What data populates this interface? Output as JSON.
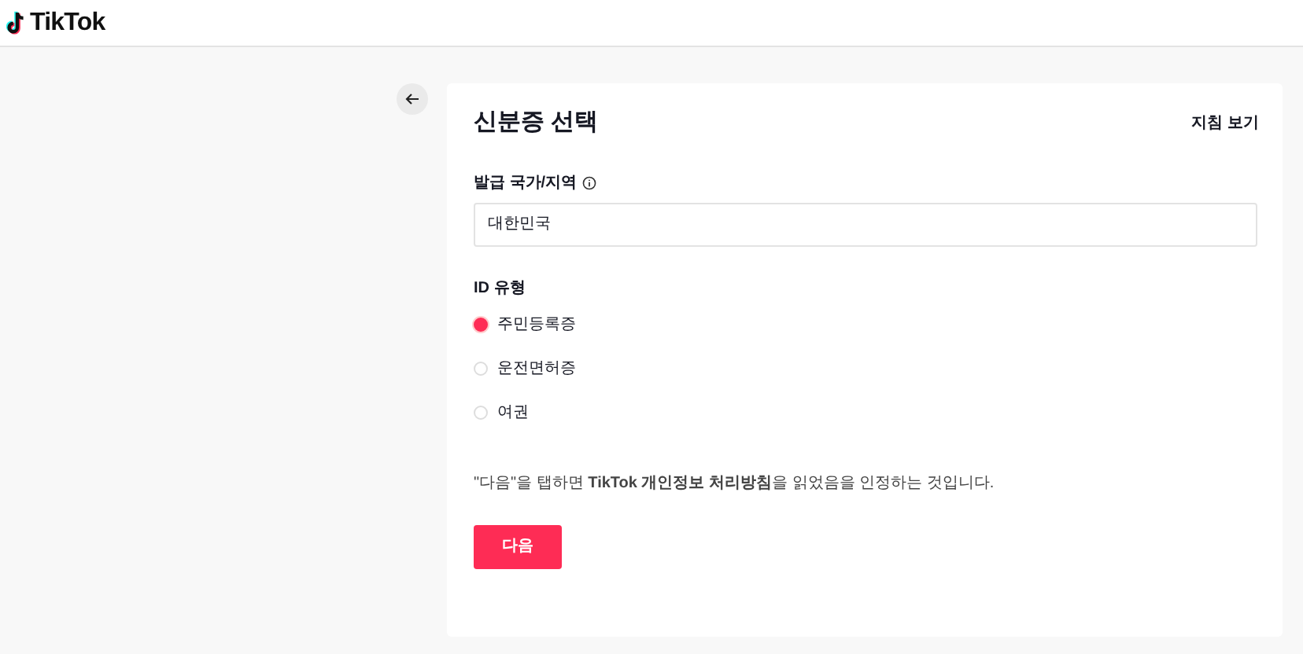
{
  "header": {
    "logo": "TikTok"
  },
  "card": {
    "title": "신분증 선택",
    "guide_link": "지침 보기",
    "country_label": "발급 국가/지역",
    "country_value": "대한민국",
    "id_type_label": "ID 유형",
    "id_types": [
      {
        "label": "주민등록증",
        "selected": true
      },
      {
        "label": "운전면허증",
        "selected": false
      },
      {
        "label": "여권",
        "selected": false
      }
    ],
    "consent": "\"다음\"을 탭하면 **TikTok 개인정보 처리방침**을 읽었음을 인정하는 것입니다.",
    "next_button": "다음"
  }
}
